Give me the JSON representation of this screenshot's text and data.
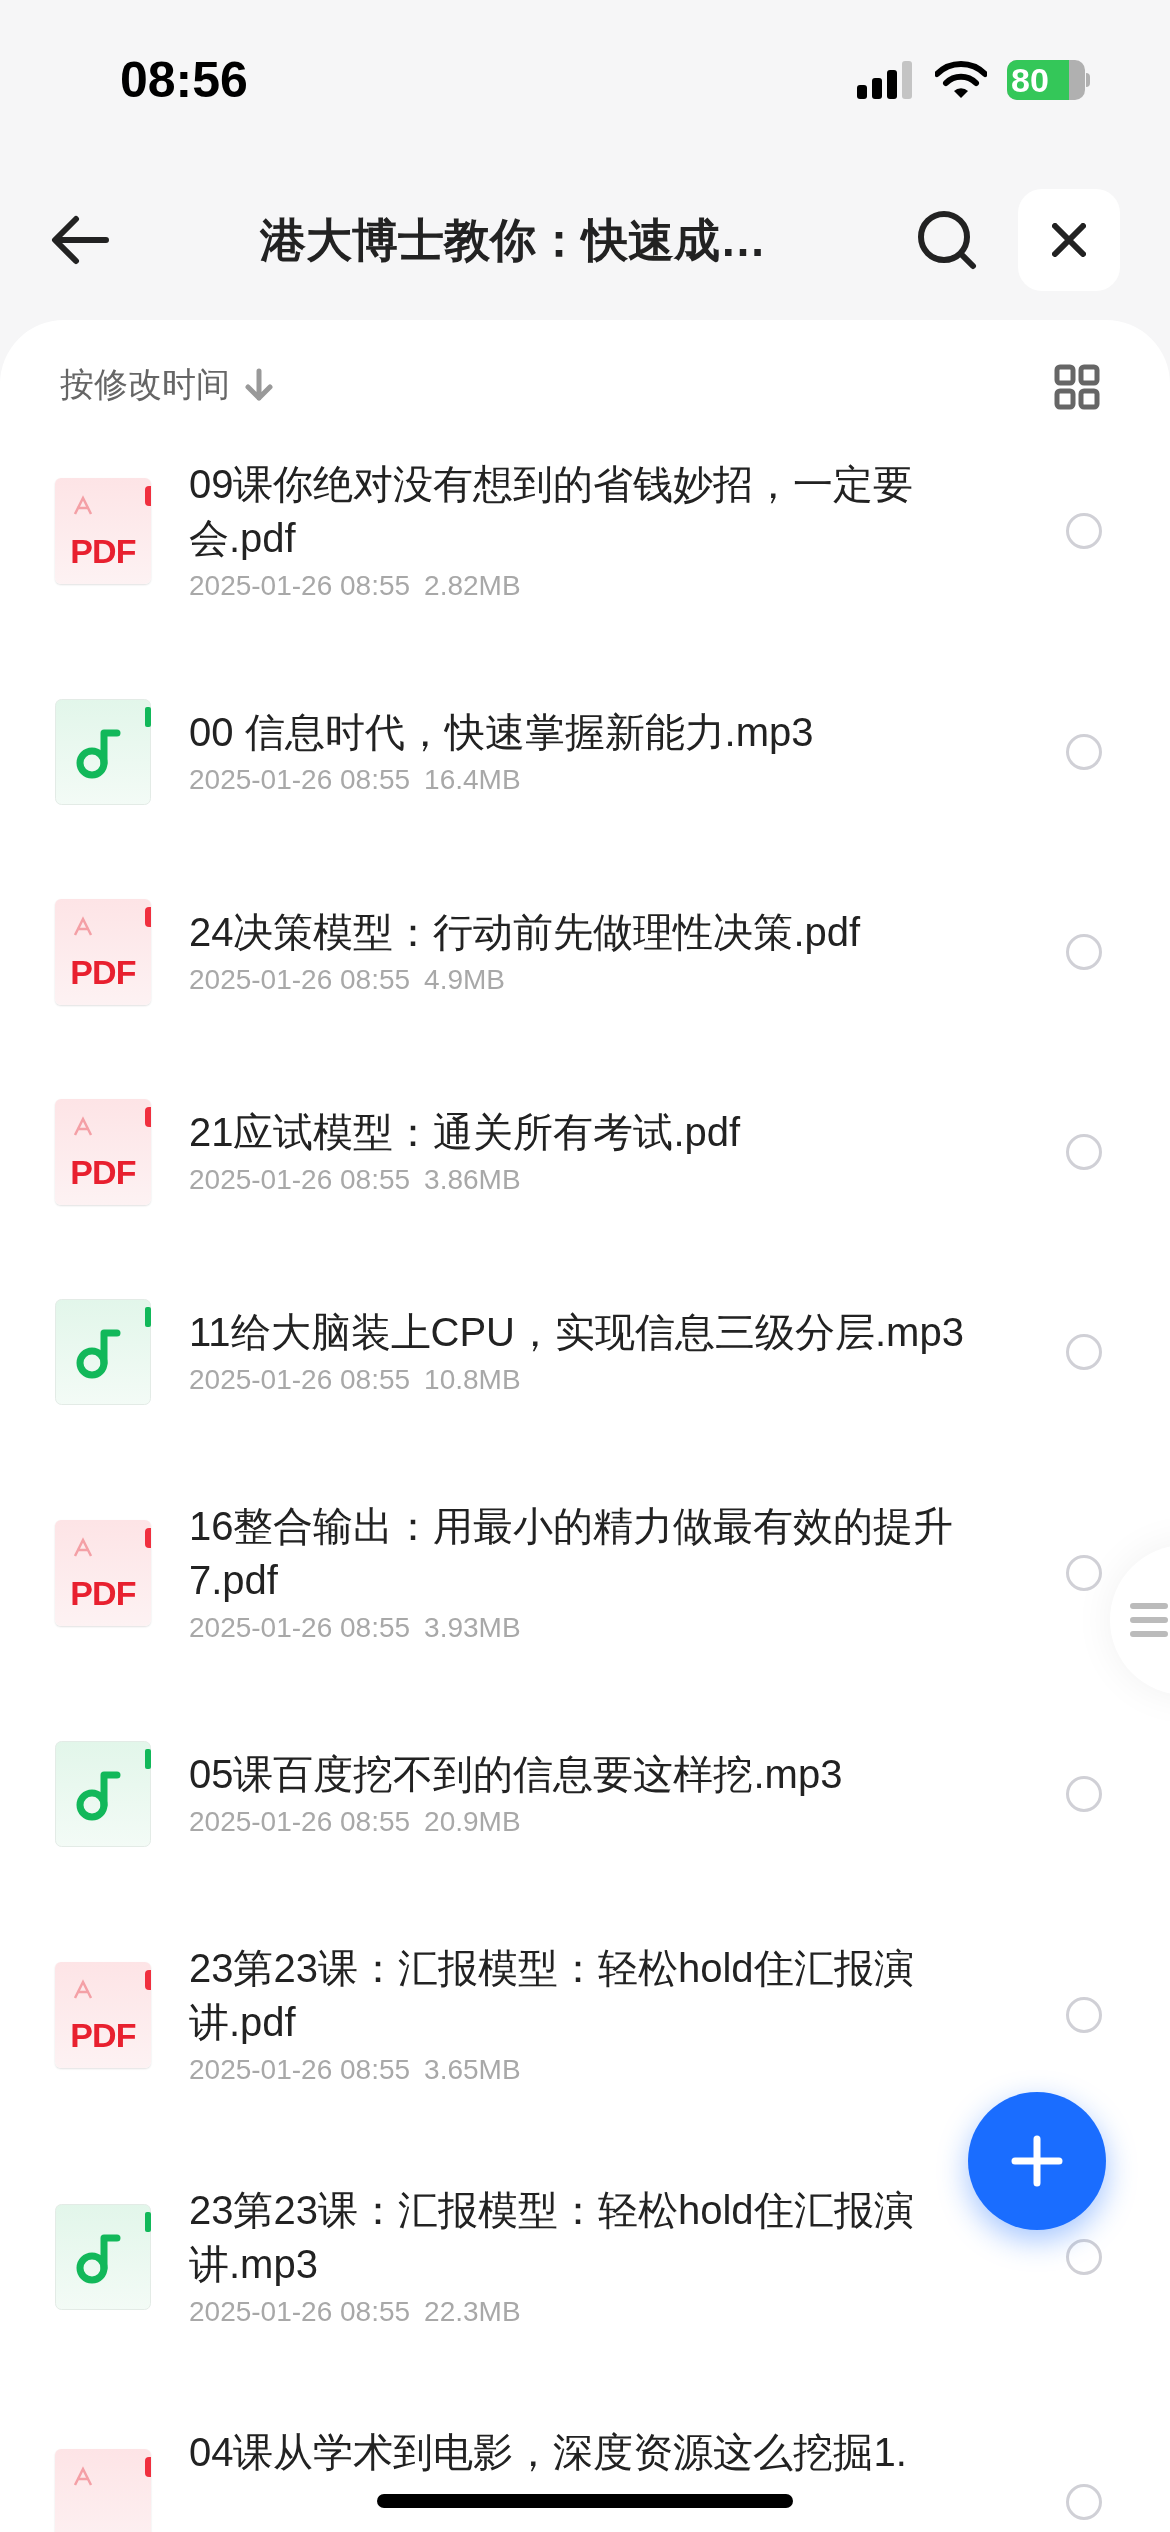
{
  "status_bar": {
    "time": "08:56",
    "battery": "80"
  },
  "nav": {
    "title": "港大博士教你：快速成…"
  },
  "sort": {
    "label": "按修改时间"
  },
  "files": [
    {
      "kind": "pdf",
      "badge": "PDF",
      "name": "09课你绝对没有想到的省钱妙招，一定要会.pdf",
      "date": "2025-01-26 08:55",
      "size": "2.82MB",
      "selected": false
    },
    {
      "kind": "mp3",
      "name": "00 信息时代，快速掌握新能力.mp3",
      "date": "2025-01-26 08:55",
      "size": "16.4MB",
      "selected": false
    },
    {
      "kind": "pdf",
      "badge": "PDF",
      "name": "24决策模型：行动前先做理性决策.pdf",
      "date": "2025-01-26 08:55",
      "size": "4.9MB",
      "selected": false
    },
    {
      "kind": "pdf",
      "badge": "PDF",
      "name": "21应试模型：通关所有考试.pdf",
      "date": "2025-01-26 08:55",
      "size": "3.86MB",
      "selected": false
    },
    {
      "kind": "mp3",
      "name": "11给大脑装上CPU，实现信息三级分层.mp3",
      "date": "2025-01-26 08:55",
      "size": "10.8MB",
      "selected": false
    },
    {
      "kind": "pdf",
      "badge": "PDF",
      "name": "16整合输出：用最小的精力做最有效的提升7.pdf",
      "date": "2025-01-26 08:55",
      "size": "3.93MB",
      "selected": false
    },
    {
      "kind": "mp3",
      "name": "05课百度挖不到的信息要这样挖.mp3",
      "date": "2025-01-26 08:55",
      "size": "20.9MB",
      "selected": false
    },
    {
      "kind": "pdf",
      "badge": "PDF",
      "name": "23第23课：汇报模型：轻松hold住汇报演讲.pdf",
      "date": "2025-01-26 08:55",
      "size": "3.65MB",
      "selected": false
    },
    {
      "kind": "mp3",
      "name": "23第23课：汇报模型：轻松hold住汇报演讲.mp3",
      "date": "2025-01-26 08:55",
      "size": "22.3MB",
      "selected": false
    },
    {
      "kind": "pdf",
      "name": "04课从学术到电影，深度资源这么挖掘1.",
      "selected": false
    }
  ]
}
